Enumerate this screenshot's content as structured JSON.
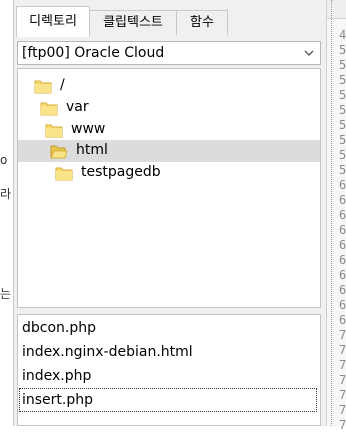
{
  "tabs": [
    {
      "label": "디렉토리",
      "active": true
    },
    {
      "label": "클립텍스트",
      "active": false
    },
    {
      "label": "함수",
      "active": false
    }
  ],
  "connection": {
    "selected": "[ftp00] Oracle Cloud"
  },
  "tree": [
    {
      "label": "/",
      "selected": false
    },
    {
      "label": "var",
      "selected": false
    },
    {
      "label": "www",
      "selected": false
    },
    {
      "label": "html",
      "selected": true
    },
    {
      "label": "testpagedb",
      "selected": false
    }
  ],
  "files": [
    {
      "label": "dbcon.php",
      "focused": false
    },
    {
      "label": "index.nginx-debian.html",
      "focused": false
    },
    {
      "label": "index.php",
      "focused": false
    },
    {
      "label": "insert.php",
      "focused": true
    }
  ],
  "left_fragments": [
    "o",
    "라",
    "는"
  ],
  "line_numbers": [
    "4",
    "5",
    "5",
    "5",
    "5",
    "5",
    "5",
    "5",
    "5",
    "5",
    "6",
    "6",
    "6",
    "6",
    "6",
    "6",
    "6",
    "6",
    "6",
    "6",
    "7",
    "7",
    "7",
    "7",
    "7",
    "7",
    "7"
  ],
  "colors": {
    "folder": "#f5d86a",
    "selection": "#dcdcdc",
    "panel_bg": "#f0f0f0"
  }
}
